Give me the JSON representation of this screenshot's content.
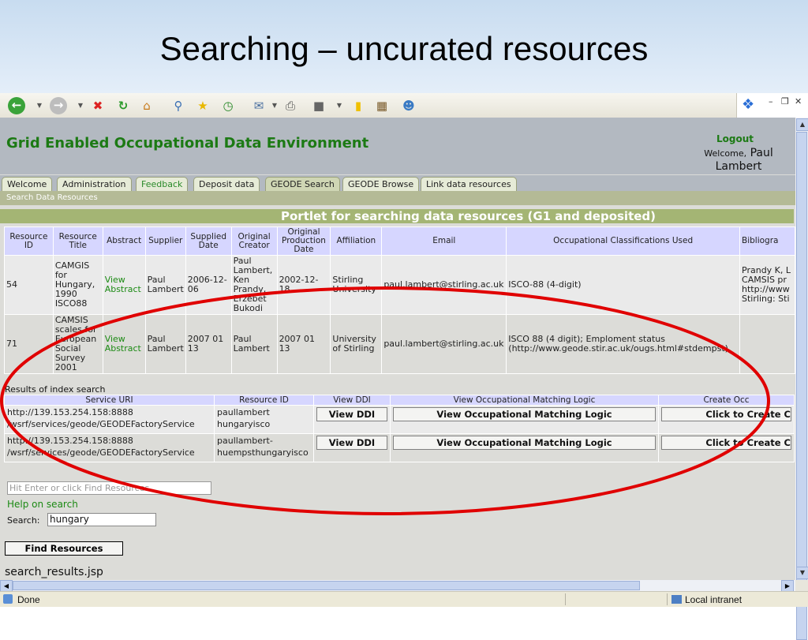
{
  "slide": {
    "title": "Searching – uncurated resources"
  },
  "app": {
    "title": "Grid Enabled Occupational Data Environment",
    "logout": "Logout",
    "welcome_prefix": "Welcome,",
    "welcome_name_line1": "Paul",
    "welcome_name_line2": "Lambert"
  },
  "tabs": [
    "Welcome",
    "Administration",
    "Feedback",
    "Deposit data",
    "GEODE Search",
    "GEODE Browse",
    "Link data resources"
  ],
  "subbar": "Search Data Resources",
  "portlet_title": "Portlet for searching data resources (G1 and deposited)",
  "results": {
    "headers": [
      "Resource ID",
      "Resource Title",
      "Abstract",
      "Supplier",
      "Supplied Date",
      "Original Creator",
      "Original Production Date",
      "Affiliation",
      "Email",
      "Occupational Classifications Used",
      "Bibliogra"
    ],
    "rows": [
      {
        "id": "54",
        "title": "CAMGIS for Hungary, 1990 ISCO88",
        "abstract": "View Abstract",
        "supplier": "Paul Lambert",
        "supplied_date": "2006-12-06",
        "creator": "Paul Lambert, Ken Prandy, Erzebet Bukodi",
        "production_date": "2002-12-18",
        "affiliation": "Stirling University",
        "email": "paul.lambert@stirling.ac.uk",
        "classifications": "ISCO-88 (4-digit)",
        "bibliography": "Prandy K, L CAMSIS pr http://www Stirling: Sti"
      },
      {
        "id": "71",
        "title": "CAMSIS scales for European Social Survey 2001",
        "abstract": "View Abstract",
        "supplier": "Paul Lambert",
        "supplied_date": "2007 01 13",
        "creator": "Paul Lambert",
        "production_date": "2007 01 13",
        "affiliation": "University of Stirling",
        "email": "paul.lambert@stirling.ac.uk",
        "classifications": "ISCO 88 (4 digit); Emploment status (http://www.geode.stir.ac.uk/ougs.html#stdempst)",
        "bibliography": ""
      }
    ]
  },
  "index": {
    "label": "Results of index search",
    "headers": [
      "Service URI",
      "Resource ID",
      "View DDI",
      "View Occupational Matching Logic",
      "Create Occ"
    ],
    "rows": [
      {
        "uri_line1": "http://139.153.254.158:8888",
        "uri_line2": "/wsrf/services/geode/GEODEFactoryService",
        "resource_line1": "paullambert",
        "resource_line2": "hungaryisco",
        "ddi": "View DDI",
        "matching": "View Occupational Matching Logic",
        "create": "Click to Create C"
      },
      {
        "uri_line1": "http://139.153.254.158:8888",
        "uri_line2": "/wsrf/services/geode/GEODEFactoryService",
        "resource_line1": "paullambert-",
        "resource_line2": "huempsthungaryisco",
        "ddi": "View DDI",
        "matching": "View Occupational Matching Logic",
        "create": "Click to Create C"
      }
    ]
  },
  "search": {
    "hint_placeholder": "Hit Enter or click Find Resources",
    "help": "Help on search",
    "label": "Search:",
    "value": "hungary",
    "button": "Find Resources"
  },
  "page_file": "search_results.jsp",
  "status": {
    "text": "Done",
    "zone": "Local intranet"
  },
  "colors": {
    "accent_green": "#1c7a14",
    "annotation_oval": "#e00000",
    "header_lavender": "#d6d6ff"
  }
}
